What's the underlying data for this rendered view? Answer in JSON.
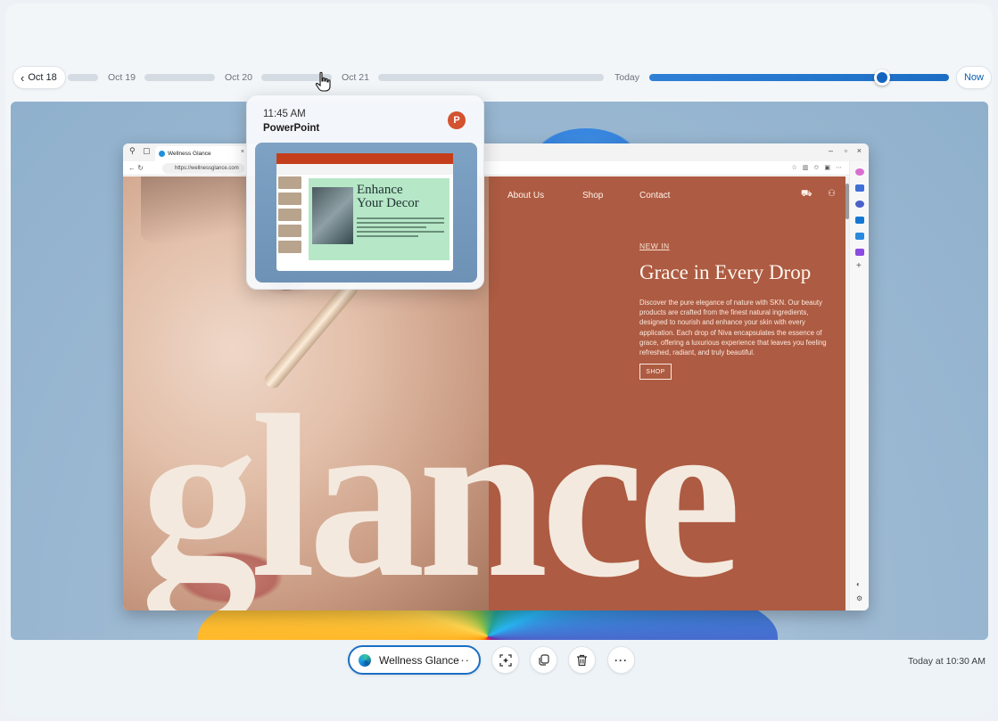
{
  "timeline": {
    "back_label": "Oct 18",
    "dates": [
      "Oct 19",
      "Oct 20",
      "Oct 21",
      "Today"
    ],
    "now_label": "Now"
  },
  "hover_card": {
    "time": "11:45 AM",
    "app": "PowerPoint",
    "app_icon": "powerpoint-icon",
    "slide_title_line1": "Enhance",
    "slide_title_line2": "Your Decor"
  },
  "browser": {
    "tab_title": "Wellness Glance",
    "url": "https://wellnessglance.com"
  },
  "website": {
    "nav": [
      "About Us",
      "Shop",
      "Contact"
    ],
    "eyebrow": "NEW IN",
    "headline": "Grace in Every Drop",
    "body": "Discover the pure elegance of nature with SKN. Our beauty products are crafted from the finest natural ingredients, designed to nourish and enhance your skin with every application. Each drop of Niva encapsulates the essence of grace, offering a luxurious experience that leaves you feeling refreshed, radiant, and truly beautiful.",
    "cta": "SHOP",
    "big_word": "glance"
  },
  "actions": {
    "chip_label": "Wellness Glance",
    "chip_more": "···",
    "more": "···",
    "icons": [
      "click-to-do-icon",
      "copy-icon",
      "delete-icon",
      "more-icon"
    ]
  },
  "timestamp": "Today at 10:30 AM",
  "colors": {
    "accent": "#1a6fc4",
    "panel": "#ad5b42",
    "powerpoint": "#d35230"
  }
}
